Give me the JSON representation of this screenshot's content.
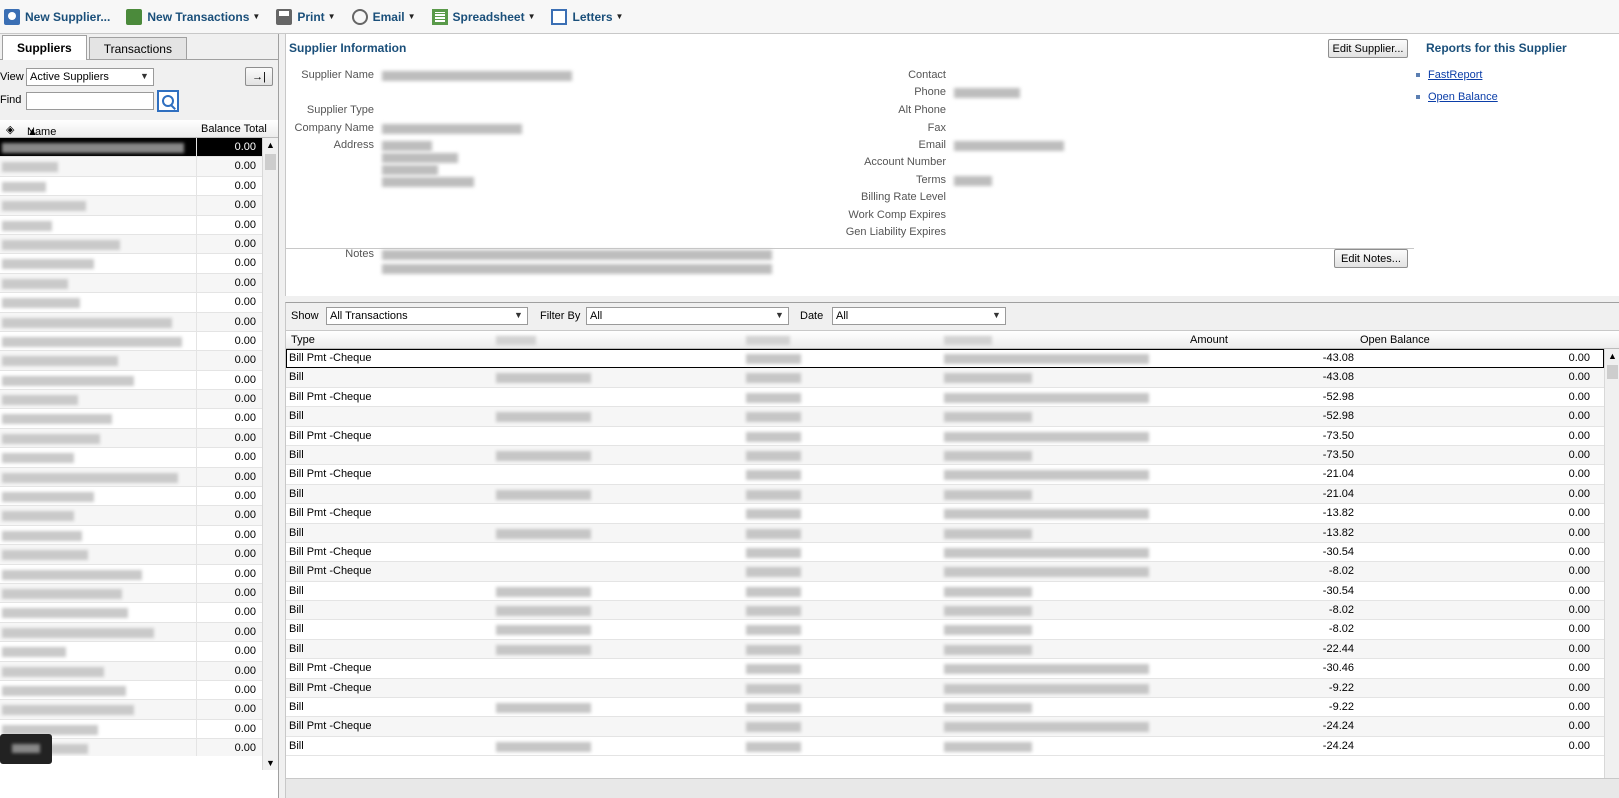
{
  "toolbar": {
    "new_supplier": "New Supplier...",
    "new_transactions": "New Transactions",
    "print": "Print",
    "email": "Email",
    "spreadsheet": "Spreadsheet",
    "letters": "Letters"
  },
  "left": {
    "tabs": [
      "Suppliers",
      "Transactions"
    ],
    "view_label": "View",
    "view_value": "Active Suppliers",
    "find_label": "Find",
    "find_value": "",
    "list_headers": {
      "name": "Name",
      "balance": "Balance Total"
    },
    "balances": [
      "0.00",
      "0.00",
      "0.00",
      "0.00",
      "0.00",
      "0.00",
      "0.00",
      "0.00",
      "0.00",
      "0.00",
      "0.00",
      "0.00",
      "0.00",
      "0.00",
      "0.00",
      "0.00",
      "0.00",
      "0.00",
      "0.00",
      "0.00",
      "0.00",
      "0.00",
      "0.00",
      "0.00",
      "0.00",
      "0.00",
      "0.00",
      "0.00",
      "0.00",
      "0.00",
      "0.00",
      "0.00"
    ]
  },
  "info": {
    "title": "Supplier Information",
    "edit_supplier": "Edit Supplier...",
    "edit_notes": "Edit Notes...",
    "labels_left": {
      "supplier_name": "Supplier Name",
      "supplier_type": "Supplier Type",
      "company_name": "Company Name",
      "address": "Address",
      "notes": "Notes"
    },
    "labels_right": {
      "contact": "Contact",
      "phone": "Phone",
      "alt_phone": "Alt Phone",
      "fax": "Fax",
      "email": "Email",
      "account_number": "Account Number",
      "terms": "Terms",
      "billing_rate_level": "Billing Rate Level",
      "work_comp_expires": "Work Comp Expires",
      "gen_liability_expires": "Gen Liability Expires"
    },
    "reports_title": "Reports for this Supplier",
    "reports": [
      "FastReport",
      "Open Balance"
    ]
  },
  "tx": {
    "show_label": "Show",
    "show_value": "All Transactions",
    "filter_label": "Filter By",
    "filter_value": "All",
    "date_label": "Date",
    "date_value": "All",
    "headers": {
      "type": "Type",
      "amount": "Amount",
      "open_balance": "Open Balance"
    },
    "rows": [
      {
        "type": "Bill Pmt -Cheque",
        "amount": "-43.08",
        "open": "0.00"
      },
      {
        "type": "Bill",
        "amount": "-43.08",
        "open": "0.00"
      },
      {
        "type": "Bill Pmt -Cheque",
        "amount": "-52.98",
        "open": "0.00"
      },
      {
        "type": "Bill",
        "amount": "-52.98",
        "open": "0.00"
      },
      {
        "type": "Bill Pmt -Cheque",
        "amount": "-73.50",
        "open": "0.00"
      },
      {
        "type": "Bill",
        "amount": "-73.50",
        "open": "0.00"
      },
      {
        "type": "Bill Pmt -Cheque",
        "amount": "-21.04",
        "open": "0.00"
      },
      {
        "type": "Bill",
        "amount": "-21.04",
        "open": "0.00"
      },
      {
        "type": "Bill Pmt -Cheque",
        "amount": "-13.82",
        "open": "0.00"
      },
      {
        "type": "Bill",
        "amount": "-13.82",
        "open": "0.00"
      },
      {
        "type": "Bill Pmt -Cheque",
        "amount": "-30.54",
        "open": "0.00"
      },
      {
        "type": "Bill Pmt -Cheque",
        "amount": "-8.02",
        "open": "0.00"
      },
      {
        "type": "Bill",
        "amount": "-30.54",
        "open": "0.00"
      },
      {
        "type": "Bill",
        "amount": "-8.02",
        "open": "0.00"
      },
      {
        "type": "Bill",
        "amount": "-8.02",
        "open": "0.00"
      },
      {
        "type": "Bill",
        "amount": "-22.44",
        "open": "0.00"
      },
      {
        "type": "Bill Pmt -Cheque",
        "amount": "-30.46",
        "open": "0.00"
      },
      {
        "type": "Bill Pmt -Cheque",
        "amount": "-9.22",
        "open": "0.00"
      },
      {
        "type": "Bill",
        "amount": "-9.22",
        "open": "0.00"
      },
      {
        "type": "Bill Pmt -Cheque",
        "amount": "-24.24",
        "open": "0.00"
      },
      {
        "type": "Bill",
        "amount": "-24.24",
        "open": "0.00"
      }
    ]
  }
}
